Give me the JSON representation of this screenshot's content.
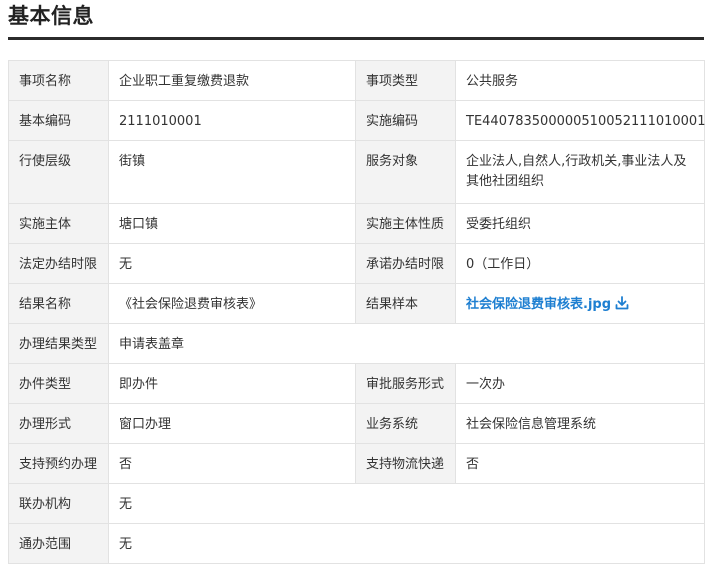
{
  "section": {
    "title": "基本信息"
  },
  "rows": [
    {
      "l1": "事项名称",
      "v1": "企业职工重复缴费退款",
      "l2": "事项类型",
      "v2": "公共服务"
    },
    {
      "l1": "基本编码",
      "v1": "2111010001",
      "l2": "实施编码",
      "v2": "TE440783500000510052111010001"
    },
    {
      "l1": "行使层级",
      "v1": "街镇",
      "l2": "服务对象",
      "v2": "企业法人,自然人,行政机关,事业法人及其他社团组织"
    },
    {
      "l1": "实施主体",
      "v1": "塘口镇",
      "l2": "实施主体性质",
      "v2": "受委托组织"
    },
    {
      "l1": "法定办结时限",
      "v1": "无",
      "l2": "承诺办结时限",
      "v2": "0（工作日）"
    },
    {
      "l1": "结果名称",
      "v1": "《社会保险退费审核表》",
      "l2": "结果样本",
      "v2": "社会保险退费审核表.jpg"
    },
    {
      "l1": "办理结果类型",
      "v1": "申请表盖章"
    },
    {
      "l1": "办件类型",
      "v1": "即办件",
      "l2": "审批服务形式",
      "v2": "一次办"
    },
    {
      "l1": "办理形式",
      "v1": "窗口办理",
      "l2": "业务系统",
      "v2": "社会保险信息管理系统"
    },
    {
      "l1": "支持预约办理",
      "v1": "否",
      "l2": "支持物流快递",
      "v2": "否"
    },
    {
      "l1": "联办机构",
      "v1": "无"
    },
    {
      "l1": "通办范围",
      "v1": "无"
    }
  ],
  "icons": {
    "download": "download-icon"
  },
  "colors": {
    "link": "#1e7fd1",
    "label_bg": "#f3f3f3",
    "border": "#e2e2e2",
    "rule": "#2b2b2b"
  }
}
